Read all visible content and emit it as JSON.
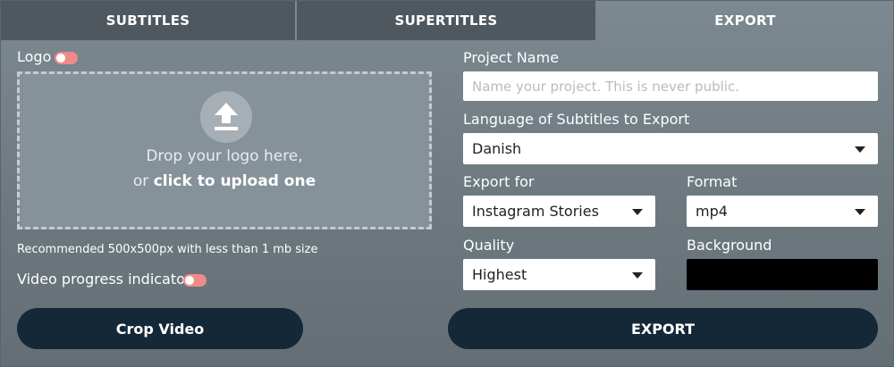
{
  "tabs": [
    {
      "label": "SUBTITLES",
      "active": false
    },
    {
      "label": "SUPERTITLES",
      "active": false
    },
    {
      "label": "EXPORT",
      "active": true
    }
  ],
  "logo": {
    "label": "Logo",
    "toggle_on": false,
    "drop_text": "Drop your logo here,",
    "drop_or": "or",
    "drop_link": "click to upload one",
    "hint": "Recommended 500x500px with less than 1 mb size"
  },
  "progress": {
    "label": "Video progress indicator",
    "toggle_on": false
  },
  "crop_button": "Crop Video",
  "project": {
    "label": "Project Name",
    "value": "",
    "placeholder": "Name your project. This is never public."
  },
  "language": {
    "label": "Language of Subtitles to Export",
    "selected": "Danish"
  },
  "export_for": {
    "label": "Export for",
    "selected": "Instagram Stories"
  },
  "format": {
    "label": "Format",
    "selected": "mp4"
  },
  "quality": {
    "label": "Quality",
    "selected": "Highest"
  },
  "background": {
    "label": "Background",
    "color": "#000000"
  },
  "export_button": "EXPORT",
  "colors": {
    "button": "#142838",
    "toggle": "#f08a8a",
    "tab_inactive": "#4f585f"
  }
}
